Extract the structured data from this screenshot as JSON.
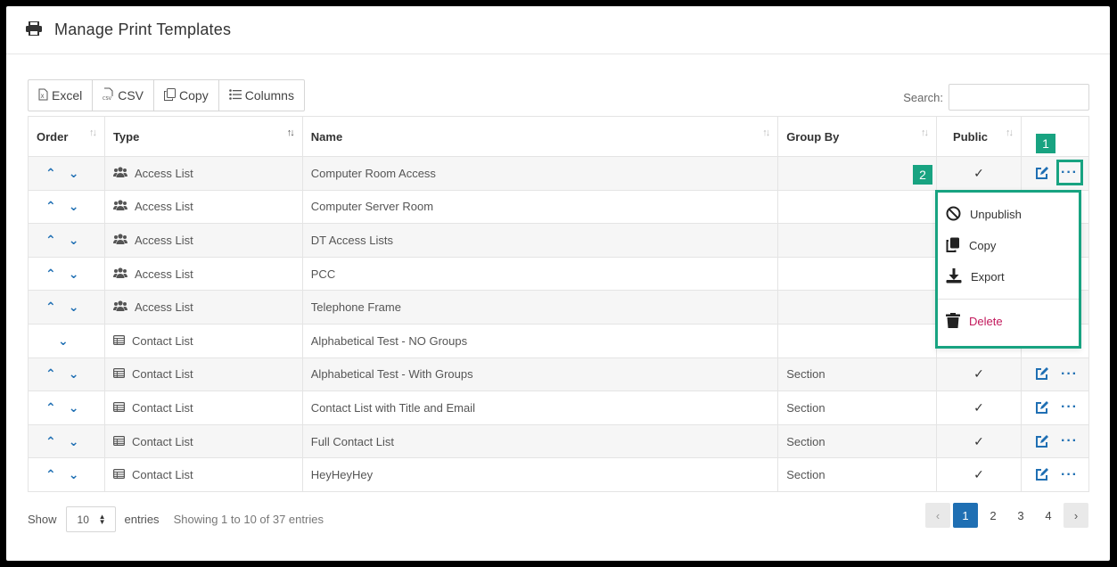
{
  "header": {
    "title": "Manage Print Templates"
  },
  "toolbar": {
    "excel": "Excel",
    "csv": "CSV",
    "copy": "Copy",
    "columns": "Columns"
  },
  "search": {
    "label": "Search:",
    "value": ""
  },
  "columns": [
    "Order",
    "Type",
    "Name",
    "Group By",
    "Public"
  ],
  "rows": [
    {
      "type": "Access List",
      "name": "Computer Room Access",
      "group_by": "",
      "public": "✓"
    },
    {
      "type": "Access List",
      "name": "Computer Server Room",
      "group_by": "",
      "public": ""
    },
    {
      "type": "Access List",
      "name": "DT Access Lists",
      "group_by": "",
      "public": ""
    },
    {
      "type": "Access List",
      "name": "PCC",
      "group_by": "",
      "public": ""
    },
    {
      "type": "Access List",
      "name": "Telephone Frame",
      "group_by": "",
      "public": ""
    },
    {
      "type": "Contact List",
      "name": "Alphabetical Test - NO Groups",
      "group_by": "",
      "public": ""
    },
    {
      "type": "Contact List",
      "name": "Alphabetical Test - With Groups",
      "group_by": "Section",
      "public": "✓"
    },
    {
      "type": "Contact List",
      "name": "Contact List with Title and Email",
      "group_by": "Section",
      "public": "✓"
    },
    {
      "type": "Contact List",
      "name": "Full Contact List",
      "group_by": "Section",
      "public": "✓"
    },
    {
      "type": "Contact List",
      "name": "HeyHeyHey",
      "group_by": "Section",
      "public": "✓"
    }
  ],
  "menu": {
    "unpublish": "Unpublish",
    "copy": "Copy",
    "export": "Export",
    "delete": "Delete"
  },
  "markers": {
    "one": "1",
    "two": "2"
  },
  "footer": {
    "show": "Show",
    "page_size": "10",
    "entries": "entries",
    "info": "Showing 1 to 10 of 37 entries"
  },
  "pager": {
    "prev": "‹",
    "pages": [
      "1",
      "2",
      "3",
      "4"
    ],
    "next": "›"
  },
  "colors": {
    "accent": "#1f6fb3",
    "highlight": "#18a381",
    "danger": "#c2185b"
  }
}
